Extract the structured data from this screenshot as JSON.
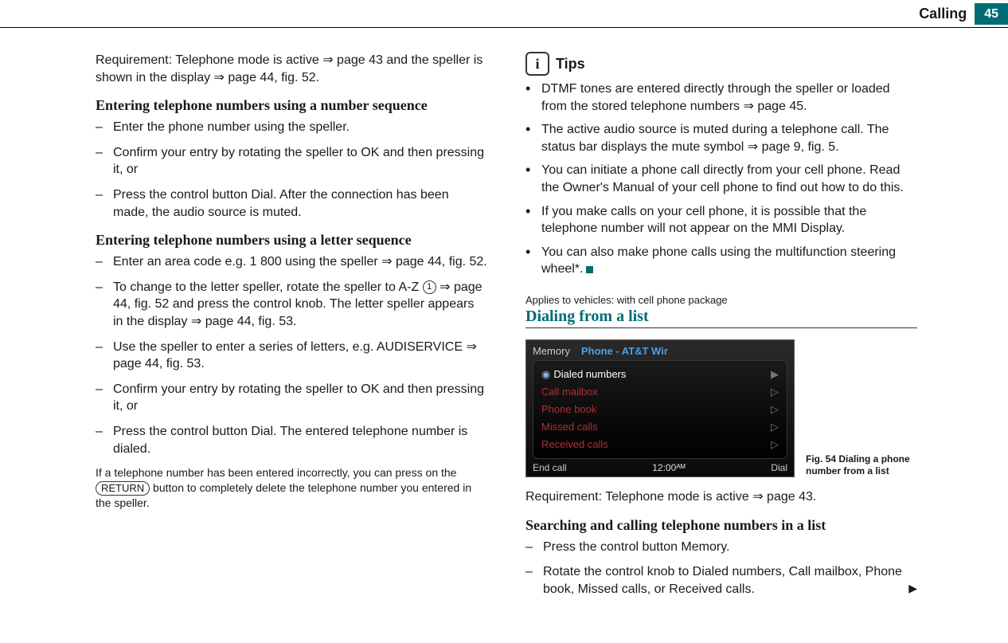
{
  "header": {
    "section": "Calling",
    "page": "45"
  },
  "col1": {
    "intro": "Requirement: Telephone mode is active ⇒ page 43 and the speller is shown in the display ⇒ page 44, fig. 52.",
    "h1": "Entering telephone numbers using a number sequence",
    "l1a": "Enter the phone number using the speller.",
    "l1b": "Confirm your entry by rotating the speller to OK and then pressing it, or",
    "l1c": "Press the control button Dial. After the connection has been made, the audio source is muted.",
    "h2": "Entering telephone numbers using a letter sequence",
    "l2a": "Enter an area code e.g. 1 800 using the speller ⇒ page 44, fig. 52.",
    "l2b_a": "To change to the letter speller, rotate the speller to A-Z ",
    "l2b_num": "1",
    "l2b_b": " ⇒ page 44, fig. 52 and press the control knob. The letter speller appears in the display ⇒ page 44, fig. 53.",
    "l2c": "Use the speller to enter a series of letters, e.g. AUDISERVICE ⇒ page 44, fig. 53.",
    "l2d": "Confirm your entry by rotating the speller to OK and then pressing it, or",
    "l2e": "Press the control button Dial. The entered telephone number is dialed.",
    "note_a": "If a telephone number has been entered incorrectly, you can press on the ",
    "note_key": "RETURN",
    "note_b": " button to completely delete the telephone number you entered in the speller."
  },
  "col2": {
    "tips_label": "Tips",
    "t1": "DTMF tones are entered directly through the speller or loaded from the stored telephone numbers ⇒ page 45.",
    "t2": "The active audio source is muted during a telephone call. The status bar displays the mute symbol ⇒ page 9, fig. 5.",
    "t3": "You can initiate a phone call directly from your cell phone. Read the Owner's Manual of your cell phone to find out how to do this.",
    "t4": "If you make calls on your cell phone, it is possible that the telephone number will not appear on the MMI Display.",
    "t5": "You can also make phone calls using the multifunction steering wheel*.",
    "applies": "Applies to vehicles: with cell phone package",
    "section": "Dialing from a list",
    "mmi": {
      "corner": "Memory",
      "title": "Phone - AT&T Wir",
      "items": [
        "Dialed numbers",
        "Call mailbox",
        "Phone book",
        "Missed calls",
        "Received calls"
      ],
      "bl": "End call",
      "clock": "12:00ᴬᴹ",
      "br": "Dial"
    },
    "figcap": "Fig. 54   Dialing a phone number from a list",
    "req": "Requirement: Telephone mode is active ⇒ page 43.",
    "h3": "Searching and calling telephone numbers in a list",
    "s1": "Press the control button Memory.",
    "s2": "Rotate the control knob to Dialed numbers, Call mailbox, Phone book, Missed calls, or Received calls."
  }
}
